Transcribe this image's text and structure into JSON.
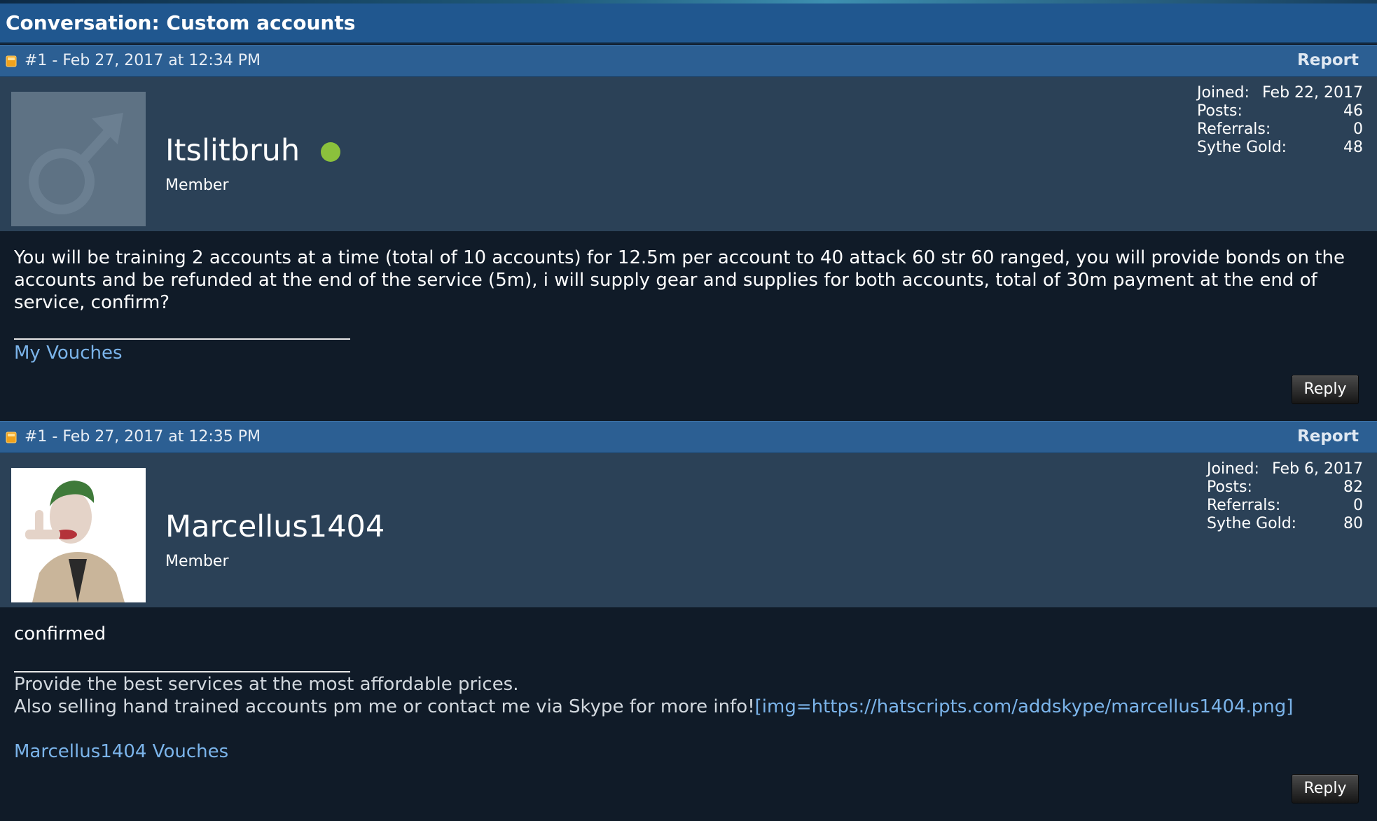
{
  "conversation": {
    "title": "Conversation: Custom accounts"
  },
  "posts": [
    {
      "meta": "#1 - Feb 27, 2017 at 12:34 PM",
      "report_label": "Report",
      "user": {
        "name": "Itslitbruh",
        "title": "Member",
        "online": true,
        "avatar": "default-male-avatar"
      },
      "stats": [
        {
          "label": "Joined:",
          "value": "Feb 22, 2017"
        },
        {
          "label": "Posts:",
          "value": "46"
        },
        {
          "label": "Referrals:",
          "value": "0"
        },
        {
          "label": "Sythe Gold:",
          "value": "48"
        }
      ],
      "message": "You will be training 2 accounts at a time (total of 10 accounts) for 12.5m per account to 40 attack 60 str 60 ranged, you will provide bonds on the accounts and be refunded at the end of the service (5m), i will supply gear and supplies for both accounts, total of 30m payment at the end of service, confirm?",
      "signature": {
        "link": "My Vouches"
      },
      "reply_label": "Reply"
    },
    {
      "meta": "#1 - Feb 27, 2017 at 12:35 PM",
      "report_label": "Report",
      "user": {
        "name": "Marcellus1404",
        "title": "Member",
        "online": false,
        "avatar": "joker-avatar"
      },
      "stats": [
        {
          "label": "Joined:",
          "value": "Feb 6, 2017"
        },
        {
          "label": "Posts:",
          "value": "82"
        },
        {
          "label": "Referrals:",
          "value": "0"
        },
        {
          "label": "Sythe Gold:",
          "value": "80"
        }
      ],
      "message": "confirmed",
      "signature": {
        "line1": "Provide the best services at the most affordable prices.",
        "line2_text": "Also selling hand trained accounts pm me or contact me via Skype for more info!",
        "line2_link": "[img=https://hatscripts.com/addskype/marcellus1404.png]",
        "link": "Marcellus1404 Vouches"
      },
      "reply_label": "Reply"
    }
  ],
  "colors": {
    "header_bg": "#20578f",
    "post_bar_bg": "#2c5f93",
    "user_panel_bg": "#2b4157",
    "body_bg": "#101b28",
    "link": "#7bb4ea",
    "online": "#8bc13c"
  }
}
